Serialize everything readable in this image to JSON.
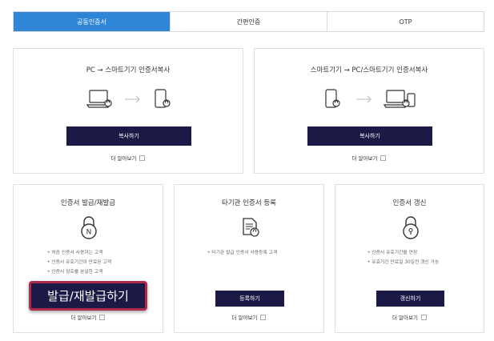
{
  "tabs": [
    "공동인증서",
    "간편인증",
    "OTP"
  ],
  "copy_cards": [
    {
      "title": "PC → 스마트기기 인증서복사",
      "button": "복사하기",
      "more": "더 알아보기"
    },
    {
      "title": "스마트기기 → PC/스마트기기 인증서복사",
      "button": "복사하기",
      "more": "더 알아보기"
    }
  ],
  "issue_card": {
    "title": "인증서 발급/재발급",
    "icon_letter": "N",
    "items": [
      "• 처음 인증서 사용하는 고객",
      "• 인증서 유효기간이 만료된 고객",
      "• 인증서 암호를 분실한 고객"
    ],
    "button": "발급/재발급하기",
    "more": "더 알아보기"
  },
  "register_card": {
    "title": "타기관 인증서 등록",
    "items": [
      "• 타기관 발급 인증서 사용등록 고객"
    ],
    "button": "등록하기",
    "more": "더 알아보기"
  },
  "renew_card": {
    "title": "인증서 갱신",
    "items": [
      "• 인증서 유효기간을 연장",
      "• 유효기간 만료일 30일전 갱신 가능"
    ],
    "button": "갱신하기",
    "more": "더 알아보기"
  },
  "colors": {
    "accent": "#2f86d6",
    "navy": "#1b1a47",
    "highlight": "#b02a4a"
  }
}
